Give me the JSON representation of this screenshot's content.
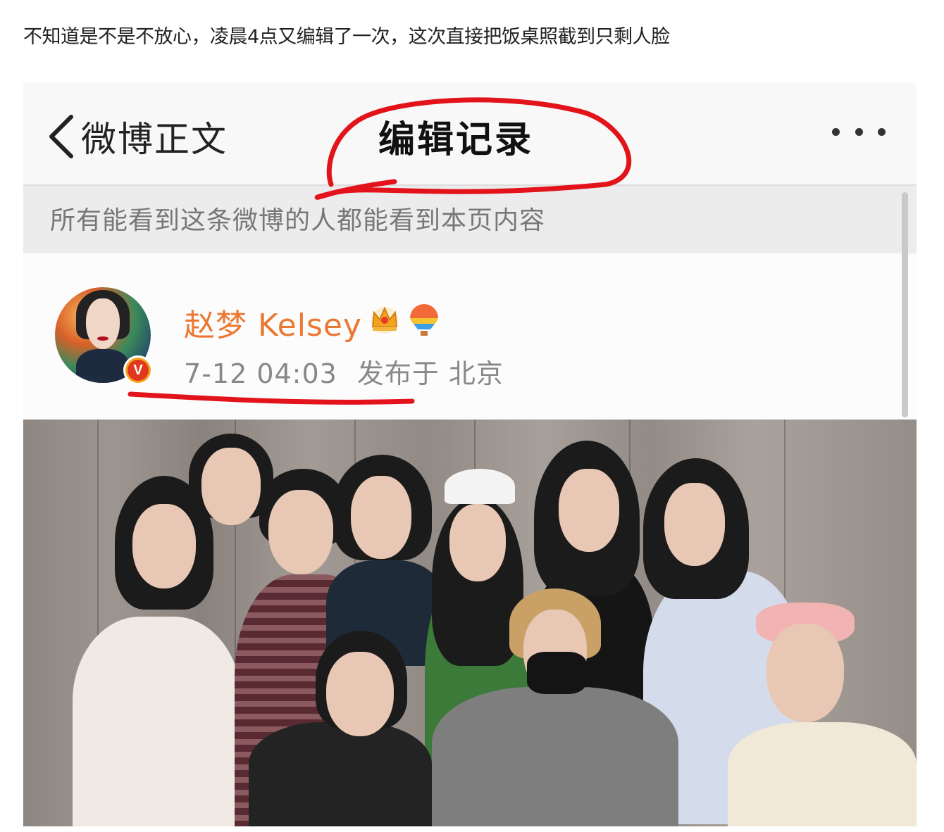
{
  "caption": "不知道是不是不放心，凌晨4点又编辑了一次，这次直接把饭桌照截到只剩人脸",
  "navbar": {
    "back_label": "微博正文",
    "title": "编辑记录",
    "more_icon": "more-dots-icon"
  },
  "notice": {
    "text": "所有能看到这条微博的人都能看到本页内容"
  },
  "post": {
    "username": "赵梦 Kelsey",
    "verified_badge": "V",
    "timestamp": "7-12 04:03",
    "location_label": "发布于 北京",
    "icons": [
      "crown-icon",
      "rainbow-balloon-icon"
    ]
  },
  "photo": {
    "description_icon": "group-photo"
  },
  "annotations": {
    "color": "#e2131a"
  }
}
